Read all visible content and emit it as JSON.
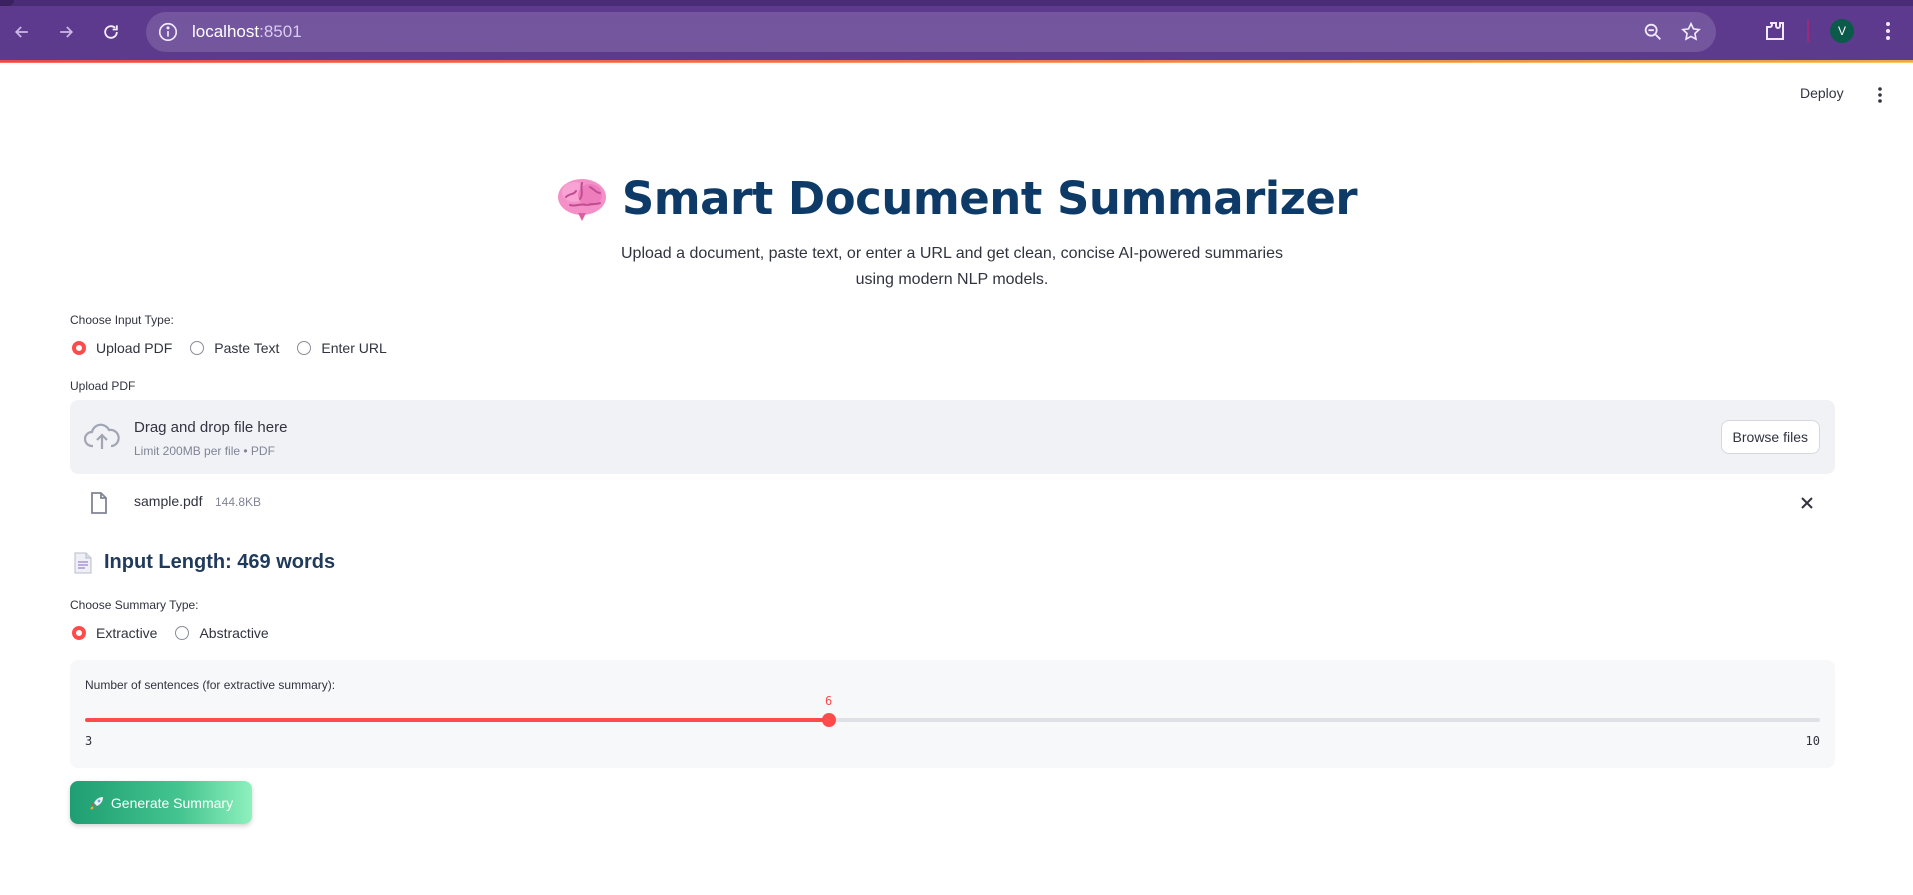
{
  "browser": {
    "url_host": "localhost",
    "url_port": ":8501",
    "profile_initial": "V"
  },
  "header": {
    "deploy_label": "Deploy"
  },
  "main": {
    "title": "Smart Document Summarizer",
    "title_icon": "brain-icon",
    "subtitle": "Upload a document, paste text, or enter a URL and get clean, concise AI-powered summaries using modern NLP models."
  },
  "input_type": {
    "label": "Choose Input Type:",
    "options": [
      "Upload PDF",
      "Paste Text",
      "Enter URL"
    ],
    "selected": "Upload PDF"
  },
  "uploader": {
    "label": "Upload PDF",
    "drop_title": "Drag and drop file here",
    "limit_text": "Limit 200MB per file • PDF",
    "browse_label": "Browse files",
    "file": {
      "name": "sample.pdf",
      "size": "144.8KB"
    }
  },
  "input_length": {
    "heading": "Input Length: 469 words",
    "icon": "page-icon"
  },
  "summary_type": {
    "label": "Choose Summary Type:",
    "options": [
      "Extractive",
      "Abstractive"
    ],
    "selected": "Extractive"
  },
  "slider": {
    "label": "Number of sentences (for extractive summary):",
    "min": 3,
    "max": 10,
    "value": 6,
    "min_label": "3",
    "max_label": "10",
    "value_label": "6"
  },
  "generate": {
    "label": "Generate Summary",
    "icon": "rocket-icon"
  },
  "colors": {
    "accent": "#ff4b4b",
    "title": "#0d3a66",
    "chrome": "#5c3b8c",
    "button_start": "#1e9e72",
    "button_end": "#8ef0bd"
  }
}
